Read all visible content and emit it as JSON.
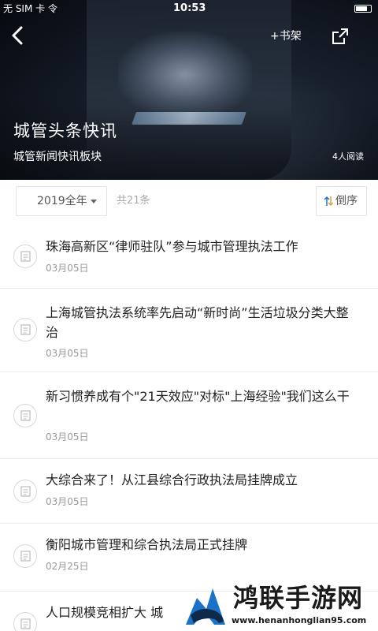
{
  "status_bar": {
    "carrier": "无 SIM 卡 令",
    "time": "10:53"
  },
  "header": {
    "back_icon": "chevron-left-icon",
    "shelf_label": "+书架",
    "share_icon": "share-icon",
    "title": "城管头条快讯",
    "subtitle": "城管新闻快讯板块",
    "read_count": "4人阅读"
  },
  "filter": {
    "year_selected": "2019全年",
    "total": "共21条",
    "sort_label": "倒序",
    "sort_icon": "sort-arrows-icon"
  },
  "news": [
    {
      "title": "珠海高新区“律师驻队”参与城市管理执法工作",
      "date": "03月05日"
    },
    {
      "title": "上海城管执法系统率先启动“新时尚”生活垃圾分类大整治",
      "date": "03月05日"
    },
    {
      "title": "新习惯养成有个\"21天效应\"对标\"上海经验\"我们这么干",
      "date": "03月05日"
    },
    {
      "title": "大综合来了！从江县综合行政执法局挂牌成立",
      "date": "03月05日"
    },
    {
      "title": "衡阳城市管理和综合执法局正式挂牌",
      "date": "02月25日"
    },
    {
      "title": "人口规模竞相扩大 城",
      "date": ""
    }
  ],
  "watermark": {
    "name": "鸿联手游网",
    "url": "www.henanhonglian95.com"
  },
  "colors": {
    "banner_dark": "#06090e",
    "divider": "#ececec",
    "date_gray": "#999999",
    "accent_blue": "#1a73c8"
  }
}
